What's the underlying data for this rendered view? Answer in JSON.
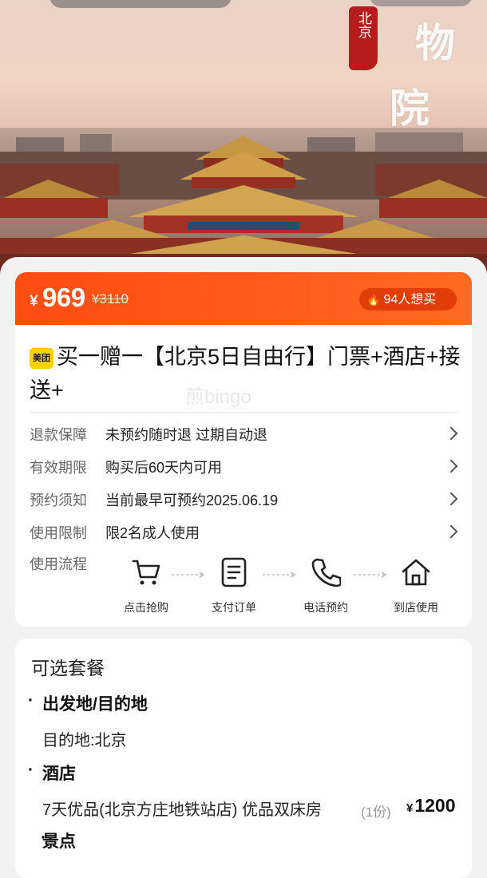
{
  "hero": {
    "seal_text": "北京",
    "calligraphy": [
      "物",
      "院"
    ]
  },
  "price": {
    "currency": "¥",
    "current": "969",
    "original": "¥3110",
    "want": "94人想买"
  },
  "product": {
    "brand_badge": "美团",
    "title": "买一赠一【北京5日自由行】门票+酒店+接送+",
    "watermark": "煎bingo"
  },
  "info_rows": [
    {
      "label": "退款保障",
      "value": "未预约随时退 过期自动退"
    },
    {
      "label": "有效期限",
      "value": "购买后60天内可用"
    },
    {
      "label": "预约须知",
      "value": "当前最早可预约2025.06.19"
    },
    {
      "label": "使用限制",
      "value": "限2名成人使用"
    }
  ],
  "flow": {
    "label": "使用流程",
    "steps": [
      {
        "label": "点击抢购",
        "icon": "cart-icon"
      },
      {
        "label": "支付订单",
        "icon": "document-icon"
      },
      {
        "label": "电话预约",
        "icon": "phone-icon"
      },
      {
        "label": "到店使用",
        "icon": "home-icon"
      }
    ]
  },
  "packages": {
    "title": "可选套餐",
    "sections": [
      {
        "heading": "出发地/目的地",
        "item": "目的地:北京"
      },
      {
        "heading": "酒店",
        "item": "7天优品(北京方庄地铁站店) 优品双床房",
        "qty": "(1份)",
        "currency": "¥",
        "price": "1200"
      }
    ],
    "next_heading_partial": "景点"
  },
  "colors": {
    "accent": "#ff5a1a",
    "badge": "#ffd100"
  }
}
